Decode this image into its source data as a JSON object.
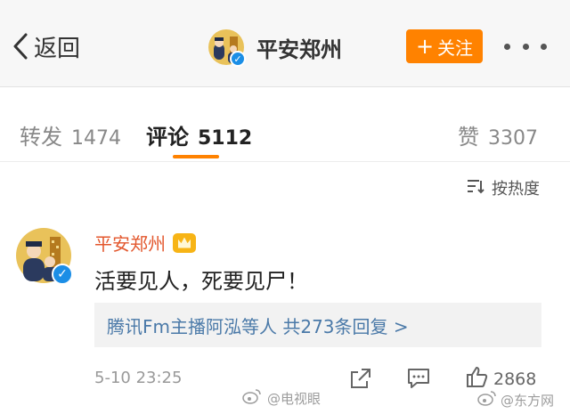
{
  "header": {
    "back_label": "返回",
    "account_name": "平安郑州",
    "follow_label": "关注"
  },
  "tabs": [
    {
      "label": "转发",
      "count": "1474"
    },
    {
      "label": "评论",
      "count": "5112"
    },
    {
      "label": "赞",
      "count": "3307"
    }
  ],
  "sort": {
    "label": "按热度"
  },
  "comment": {
    "author": "平安郑州",
    "text": "活要见人，死要见尸！",
    "replies_text": "腾讯Fm主播阿泓等人 共273条回复 >",
    "time": "5-10 23:25",
    "likes": "2868"
  },
  "watermarks": {
    "left": "@电视眼",
    "right": "@东方网"
  },
  "colors": {
    "accent": "#ff8200",
    "name": "#e3572d",
    "link": "#4a79a8",
    "verified": "#1b8ee6"
  },
  "icons": [
    "chevron-left-icon",
    "plus-icon",
    "more-dots-icon",
    "sort-icon",
    "verified-icon",
    "crown-icon",
    "share-icon",
    "comment-icon",
    "thumbs-up-icon",
    "weibo-icon"
  ]
}
